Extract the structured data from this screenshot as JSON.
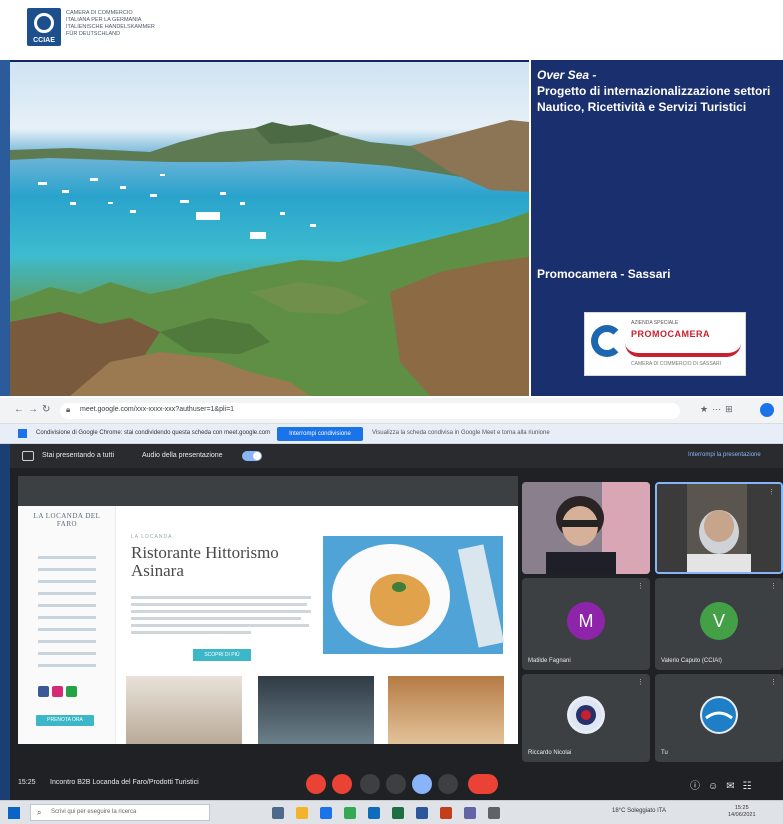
{
  "header": {
    "badge_text": "CCIAE",
    "lines": [
      "CAMERA DI COMMERCIO",
      "ITALIANA PER LA GERMANIA",
      "ITALIENISCHE HANDELSKAMMER",
      "FÜR DEUTSCHLAND"
    ]
  },
  "slide": {
    "title_italic": "Over Sea -",
    "title": "Progetto di internazionalizzazione settori Nautico, Ricettività e Servizi Turistici",
    "subtitle": "Promocamera - Sassari",
    "logo_name": "PROMOCAMERA",
    "logo_small": "AZIENDA SPECIALE",
    "logo_tag": "CAMERA DI COMMERCIO DI SASSARI"
  },
  "browser": {
    "url": "meet.google.com/xxx-xxxx-xxx?authuser=1&pli=1",
    "info_text": "Condivisione di Google Chrome: stai condividendo questa scheda con meet.google.com",
    "info_button": "Interrompi condivisione",
    "info_link": "Visualizza la scheda condivisa in Google Meet e torna alla riunione"
  },
  "meet": {
    "topbar_left": "Stai presentando a tutti",
    "topbar_middle": "Audio della presentazione",
    "topbar_right": "Interrompi la presentazione",
    "site": {
      "logo": "LA LOCANDA DEL FARO",
      "kicker": "LA LOCANDA",
      "title": "Ristorante Hittorismo Asinara",
      "button": "SCOPRI DI PIÙ",
      "cta": "PRENOTA ORA"
    },
    "participants": [
      {
        "name": ""
      },
      {
        "name": ""
      },
      {
        "name": "Matilde Fagnani",
        "initial": "M",
        "color": "#8e24aa"
      },
      {
        "name": "Valerio Caputo (CCIAI)",
        "initial": "V",
        "color": "#43a047"
      },
      {
        "name": "Riccardo Nicolai"
      },
      {
        "name": "Tu"
      }
    ],
    "bottom_time": "15:25",
    "bottom_title": "Incontro B2B Locanda del Faro/Prodotti Turistici"
  },
  "taskbar": {
    "search_placeholder": "Scrivi qui per eseguire la ricerca",
    "tray_text": "18°C  Soleggiato  ITA",
    "clock_time": "15:25",
    "clock_date": "14/06/2021"
  },
  "colors": {
    "slide_panel": "#1a2f6e",
    "meet_bg": "#202124",
    "accent_blue": "#1a73e8",
    "end_call_red": "#ea4335",
    "site_teal": "#3bb7c8"
  }
}
